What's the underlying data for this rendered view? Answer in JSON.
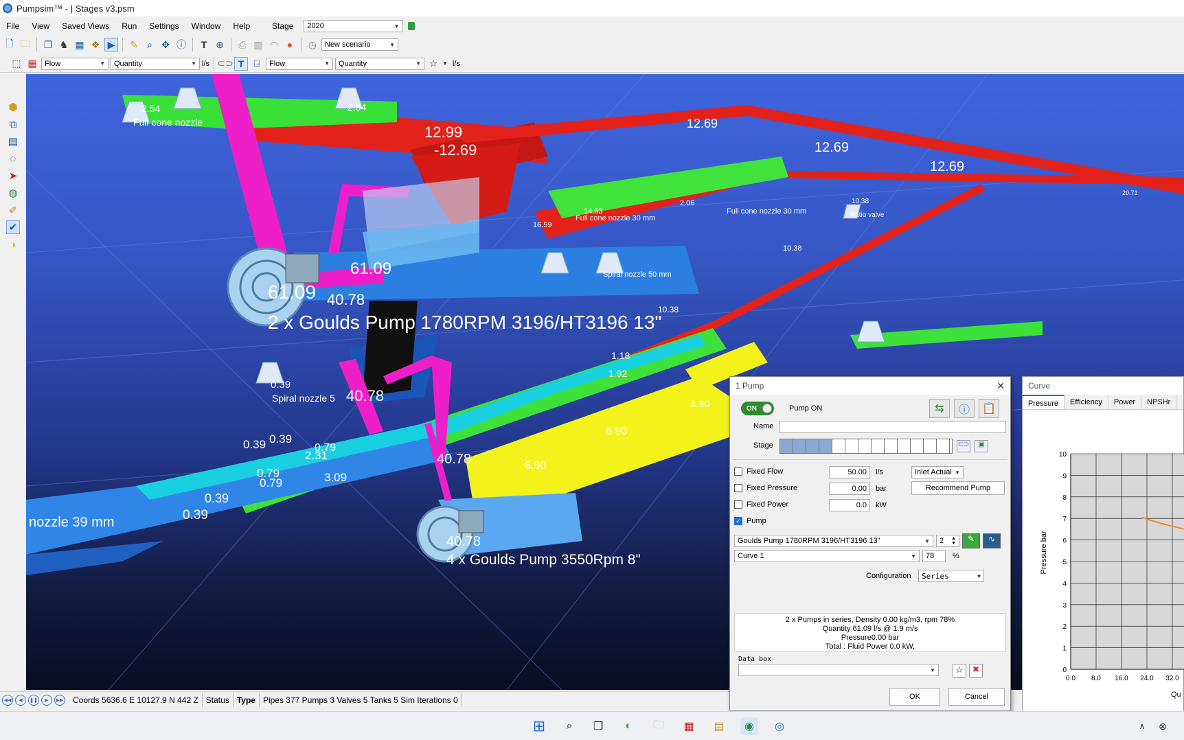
{
  "window": {
    "title": "Pumpsim™ -   |  Stages v3.psm"
  },
  "menu": {
    "items": [
      "File",
      "View",
      "Saved Views",
      "Run",
      "Settings",
      "Window",
      "Help"
    ],
    "stage_label": "Stage",
    "stage_value": "2020"
  },
  "toolbar1": {
    "scenario": "New scenario"
  },
  "toolbar2": {
    "combo1": "Flow",
    "combo2": "Quantity",
    "unit1": "l/s",
    "combo3": "Flow",
    "combo4": "Quantity",
    "unit2": "l/s",
    "text_btn": "T"
  },
  "viewport": {
    "big_labels": {
      "pump1_name": "2 x Goulds Pump 1780RPM 3196/HT3196 13\"",
      "pump2_name": "4 x Goulds Pump 3550Rpm 8\"",
      "v6109a": "61.09",
      "v6109b": "61.09",
      "v4078a": "40.78",
      "v4078b": "40.78",
      "v4078c": "40.78",
      "v4078d": "40.78",
      "v1299": "12.99",
      "v1269a": "-12.69",
      "v1269b": "12.69",
      "v1269c": "12.69",
      "v1269d": "12.69"
    },
    "small_labels": {
      "full_cone_1": "Full cone nozzle",
      "full_cone_2": "Full cone nozzle  30 mm",
      "full_cone_3": "Full cone nozzle  30 mm",
      "ratio_valve": "Ratio valve",
      "spiral_1": "Spiral nozzle  5",
      "spiral_2": "Spiral nozzle  50 mm",
      "nozzle_mm": "nozzle  39 mm",
      "v254a": "2.54",
      "v254b": "2.54",
      "v1038a": "10.38",
      "v1038b": "10.38",
      "v1038c": "10.38",
      "v039a": "0.39",
      "v039b": "0.39",
      "v039c": "0.39",
      "v039d": "0.39",
      "v039e": "0.39",
      "v079a": "0.79",
      "v079b": "0.79",
      "v079c": "0.79",
      "v231": "2.31",
      "v309": "3.09",
      "v690a": "6.90",
      "v690b": "6.90",
      "v690c": "6.90",
      "v118": "1.18",
      "v192": "1.92",
      "v1659": "16.59",
      "v1453": "14.53",
      "v206": "2.06",
      "v2071": "20.71"
    }
  },
  "statusbar": {
    "coords": "Coords 5636.6 E    10127.9 N   442 Z",
    "status": "Status",
    "type": "Type",
    "counts": "Pipes 377  Pumps 3  Valves 5  Tanks 5 Sim Iterations 0"
  },
  "pump_dialog": {
    "title": "1 Pump",
    "toggle": "ON",
    "pump_on": "Pump ON",
    "name_label": "Name",
    "name_value": "",
    "stage_label": "Stage",
    "fixed_flow_label": "Fixed Flow",
    "fixed_flow_value": "50.00",
    "fixed_flow_unit": "l/s",
    "inlet_value": "Inlet Actual",
    "fixed_pressure_label": "Fixed Pressure",
    "fixed_pressure_value": "0.00",
    "fixed_pressure_unit": "bar",
    "recommend_btn": "Recommend Pump",
    "fixed_power_label": "Fixed Power",
    "fixed_power_value": "0.0",
    "fixed_power_unit": "kW",
    "pump_label": "Pump",
    "pump_model": "Goulds Pump 1780RPM 3196/HT3196 13\"",
    "pump_count": "2",
    "curve_value": "Curve 1",
    "speed_value": "78",
    "speed_unit": "%",
    "configuration_label": "Configuration",
    "configuration_value": "Series",
    "info_lines": [
      "2 x Pumps in series,  Density   0.00 kg/m3,  rpm 78%",
      "Quantity 61.09 l/s @  1.9 m/s",
      "Pressure0.00 bar",
      "Total : Fluid Power 0.0 kW,"
    ],
    "data_box_label": "Data box",
    "ok_btn": "OK",
    "cancel_btn": "Cancel"
  },
  "curve_panel": {
    "title": "Curve",
    "tabs": [
      "Pressure",
      "Efficiency",
      "Power",
      "NPSHr"
    ],
    "ylabel": "Pressure bar",
    "xlabel": "Qu",
    "y_ticks": [
      "10",
      "9",
      "8",
      "7",
      "6",
      "5",
      "4",
      "3",
      "2",
      "1",
      "0"
    ],
    "x_ticks": [
      "0.0",
      "8.0",
      "16.0",
      "24.0",
      "32.0"
    ],
    "curve_color": "#f08a24"
  },
  "colors": {
    "accent": "#1c6fd6",
    "pipe_red": "#e0201a",
    "pipe_green": "#3ee13a",
    "pipe_yellow": "#f2f218",
    "pipe_blue": "#2f86e6",
    "pipe_magenta": "#ee1fc9"
  }
}
